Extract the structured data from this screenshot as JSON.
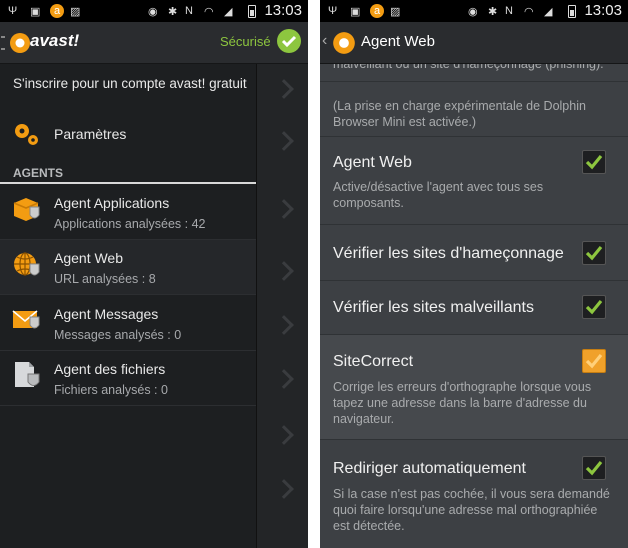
{
  "status_bar": {
    "time": "13:03"
  },
  "left_screen": {
    "app_title": "avast!",
    "status_label": "Sécurisé",
    "signup_text": "S'inscrire pour un compte avast! gratuit",
    "settings_label": "Paramètres",
    "section_header": "AGENTS",
    "agents": [
      {
        "title": "Agent Applications",
        "subtitle": "Applications analysées : 42"
      },
      {
        "title": "Agent Web",
        "subtitle": "URL analysées : 8"
      },
      {
        "title": "Agent Messages",
        "subtitle": "Messages analysés : 0"
      },
      {
        "title": "Agent des fichiers",
        "subtitle": "Fichiers analysés : 0"
      }
    ]
  },
  "right_screen": {
    "title": "Agent Web",
    "top_cut_text": "malveillant ou un site d'hameçonnage (phishing).",
    "dolphin_note_1": "(La prise en charge expérimentale de Dolphin",
    "dolphin_note_2": "Browser Mini est activée.)",
    "settings": [
      {
        "title": "Agent Web",
        "desc": "Active/désactive l'agent avec tous ses composants.",
        "checked": true
      },
      {
        "title": "Vérifier les sites d'hameçonnage",
        "desc": "",
        "checked": true
      },
      {
        "title": "Vérifier les sites malveillants",
        "desc": "",
        "checked": true
      },
      {
        "title": "SiteCorrect",
        "desc": "Corrige les erreurs d'orthographe lorsque vous tapez une adresse dans la barre d'adresse du navigateur.",
        "checked": true
      },
      {
        "title": "Rediriger automatiquement",
        "desc": "Si la case n'est pas cochée, il vous sera demandé quoi faire lorsqu'une adresse mal orthographiée est détectée.",
        "checked": true
      }
    ]
  },
  "colors": {
    "accent_green": "#8dc63f",
    "accent_orange": "#f0a12a"
  }
}
